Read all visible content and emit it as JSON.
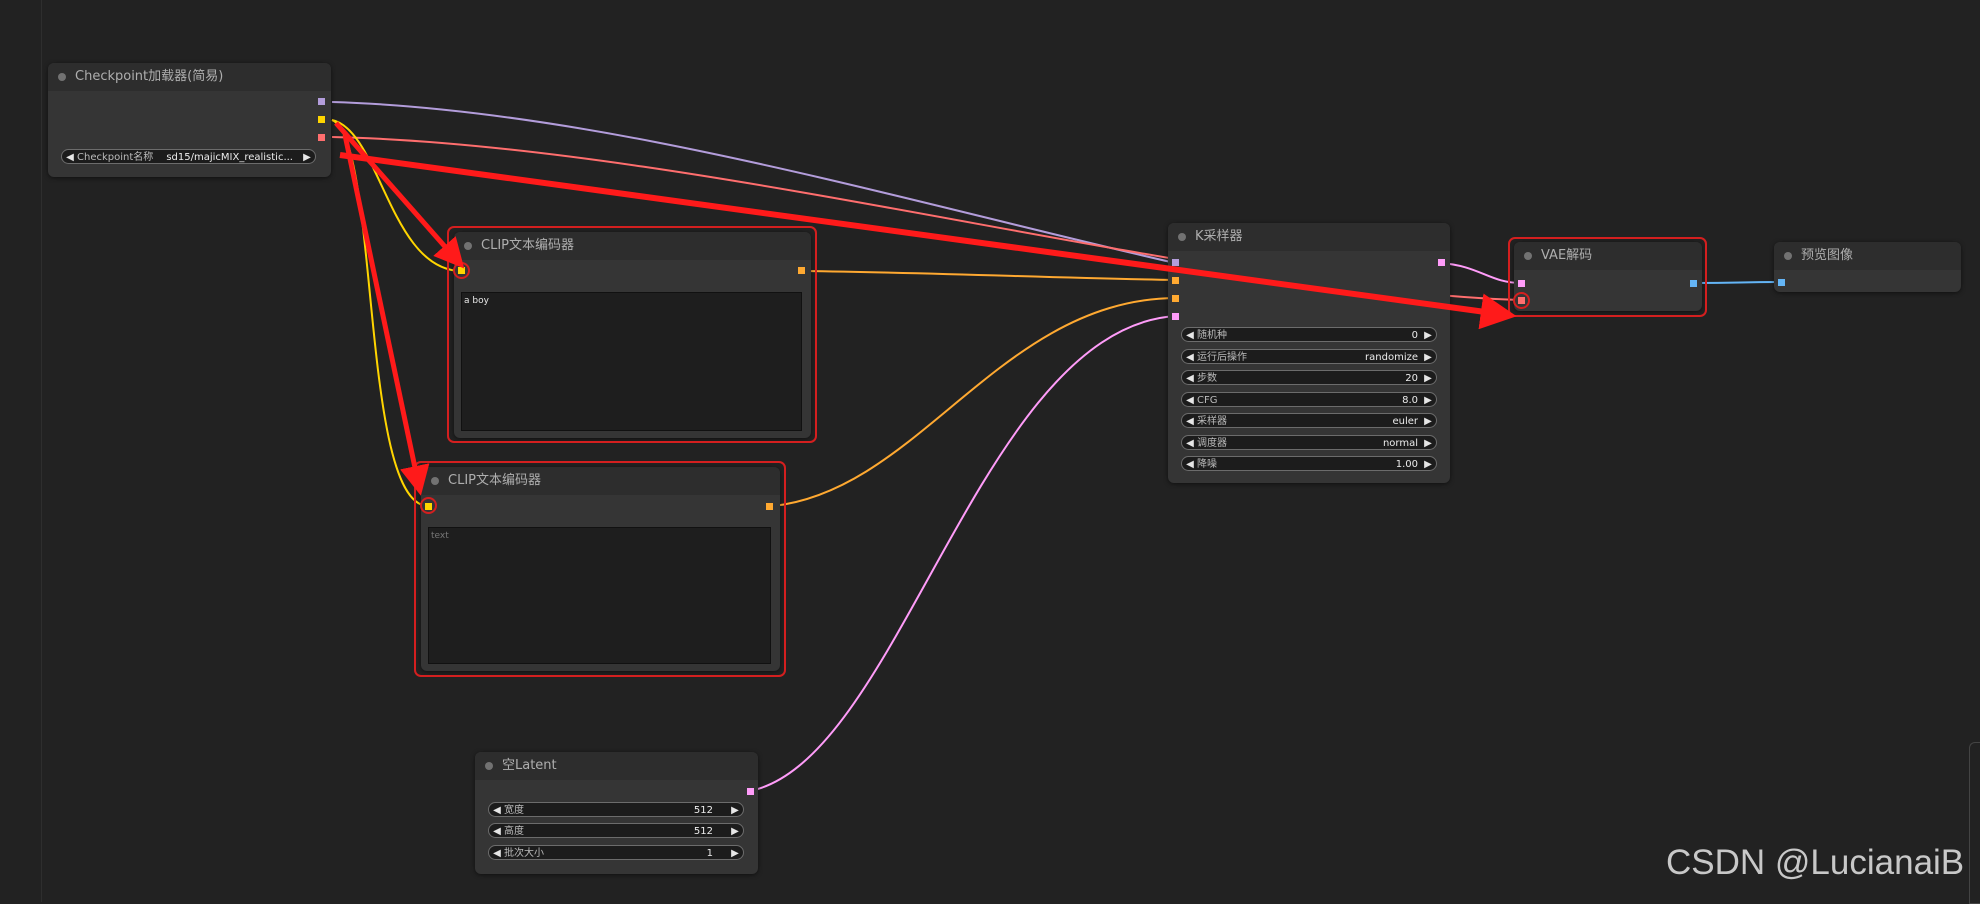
{
  "colors": {
    "canvas": "#222222",
    "node_bg": "#353535",
    "node_title_bg": "#2d2d2d",
    "model": "#b39ddb",
    "clip": "#ffd500",
    "vae": "#ff6e6e",
    "conditioning": "#ffa931",
    "latent": "#ff9cf9",
    "image": "#64b5f6",
    "annotation_red": "#ff1a1a"
  },
  "nodes": {
    "checkpoint": {
      "title": "Checkpoint加载器(简易)",
      "widget": {
        "label": "Checkpoint名称",
        "value": "sd15/majicMIX_realistic..."
      }
    },
    "clip_pos": {
      "title": "CLIP文本编码器",
      "text": "a boy"
    },
    "clip_neg": {
      "title": "CLIP文本编码器",
      "placeholder": "text"
    },
    "latent": {
      "title": "空Latent",
      "widgets": [
        {
          "label": "宽度",
          "value": "512"
        },
        {
          "label": "高度",
          "value": "512"
        },
        {
          "label": "批次大小",
          "value": "1"
        }
      ]
    },
    "ksampler": {
      "title": "K采样器",
      "widgets": [
        {
          "label": "随机种",
          "value": "0"
        },
        {
          "label": "运行后操作",
          "value": "randomize"
        },
        {
          "label": "步数",
          "value": "20"
        },
        {
          "label": "CFG",
          "value": "8.0"
        },
        {
          "label": "采样器",
          "value": "euler"
        },
        {
          "label": "调度器",
          "value": "normal"
        },
        {
          "label": "降噪",
          "value": "1.00"
        }
      ]
    },
    "vae_decode": {
      "title": "VAE解码"
    },
    "preview": {
      "title": "预览图像"
    }
  },
  "widget_arrows": {
    "left": "◀",
    "right": "▶"
  },
  "watermark": "CSDN @LucianaiB"
}
